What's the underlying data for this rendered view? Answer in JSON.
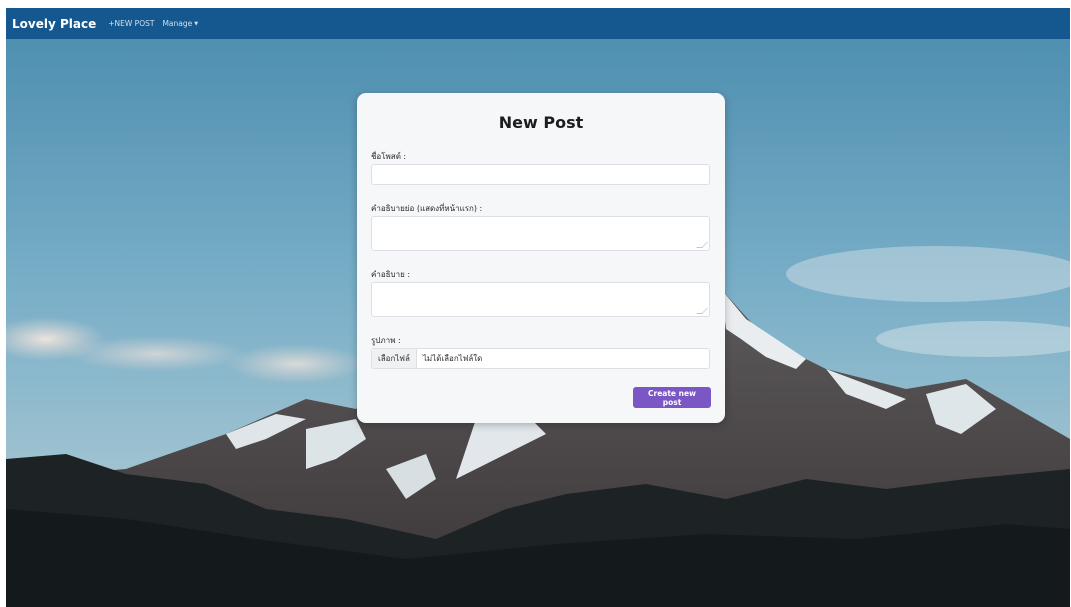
{
  "navbar": {
    "brand": "Lovely Place",
    "links": [
      {
        "label": "+NEW POST"
      },
      {
        "label": "Manage"
      }
    ],
    "bg_color": "#14588f"
  },
  "form": {
    "title": "New Post",
    "fields": {
      "title_label": "ชื่อโพสต์ :",
      "short_desc_label": "คำอธิบายย่อ (แสดงที่หน้าแรก) :",
      "desc_label": "คำอธิบาย :",
      "image_label": "รูปภาพ :"
    },
    "values": {
      "title": "",
      "short_desc": "",
      "desc": ""
    },
    "file": {
      "button_label": "เลือกไฟล์",
      "status": "ไม่ได้เลือกไฟล์ใด"
    },
    "submit_label": "Create new post",
    "accent_color": "#7b57c5"
  }
}
